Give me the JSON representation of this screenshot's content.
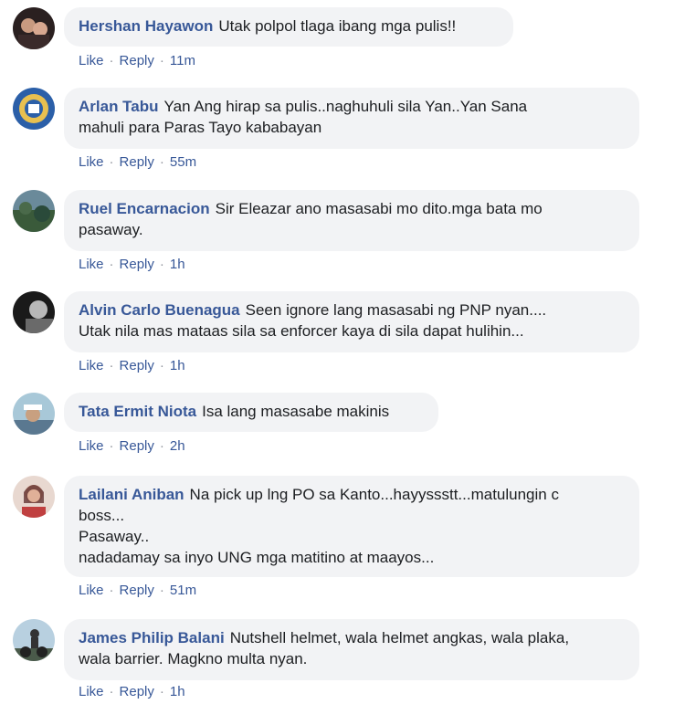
{
  "comments": [
    {
      "name": "Hershan Hayawon",
      "text": "Utak polpol tlaga ibang mga pulis!!",
      "like": "Like",
      "reply": "Reply",
      "time": "11m",
      "avatar": "avatar-couple",
      "color": "#3a3030"
    },
    {
      "name": "Arlan Tabu",
      "text": "Yan Ang hirap sa pulis..naghuhuli sila Yan..Yan Sana\nmahuli para Paras Tayo kababayan",
      "like": "Like",
      "reply": "Reply",
      "time": "55m",
      "avatar": "avatar-badge",
      "color": "#2b5fa8"
    },
    {
      "name": "Ruel Encarnacion",
      "text": "Sir Eleazar ano masasabi mo dito.mga bata mo\npasaway.",
      "like": "Like",
      "reply": "Reply",
      "time": "1h",
      "avatar": "avatar-landscape",
      "color": "#4a6a4a"
    },
    {
      "name": "Alvin Carlo Buenagua",
      "text": "Seen ignore lang masasabi ng PNP nyan....\nUtak nila mas mataas sila sa enforcer kaya di sila dapat hulihin...",
      "like": "Like",
      "reply": "Reply",
      "time": "1h",
      "avatar": "avatar-dark",
      "color": "#4a4a4a"
    },
    {
      "name": "Tata Ermit Niota",
      "text": "Isa lang masasabe makinis",
      "like": "Like",
      "reply": "Reply",
      "time": "2h",
      "avatar": "avatar-cap",
      "color": "#7a9ab0"
    },
    {
      "name": "Lailani Aniban",
      "text": "Na pick up lng PO sa Kanto...hayyssstt...matulungin c\nboss...\nPasaway..\nnadadamay sa inyo UNG mga matitino at maayos...",
      "like": "Like",
      "reply": "Reply",
      "time": "51m",
      "avatar": "avatar-woman",
      "color": "#c07060"
    },
    {
      "name": "James Philip Balani",
      "text": "Nutshell helmet, wala helmet angkas, wala plaka,\nwala barrier. Magkno multa nyan.",
      "like": "Like",
      "reply": "Reply",
      "time": "1h",
      "avatar": "avatar-rider",
      "color": "#5a7890"
    }
  ]
}
